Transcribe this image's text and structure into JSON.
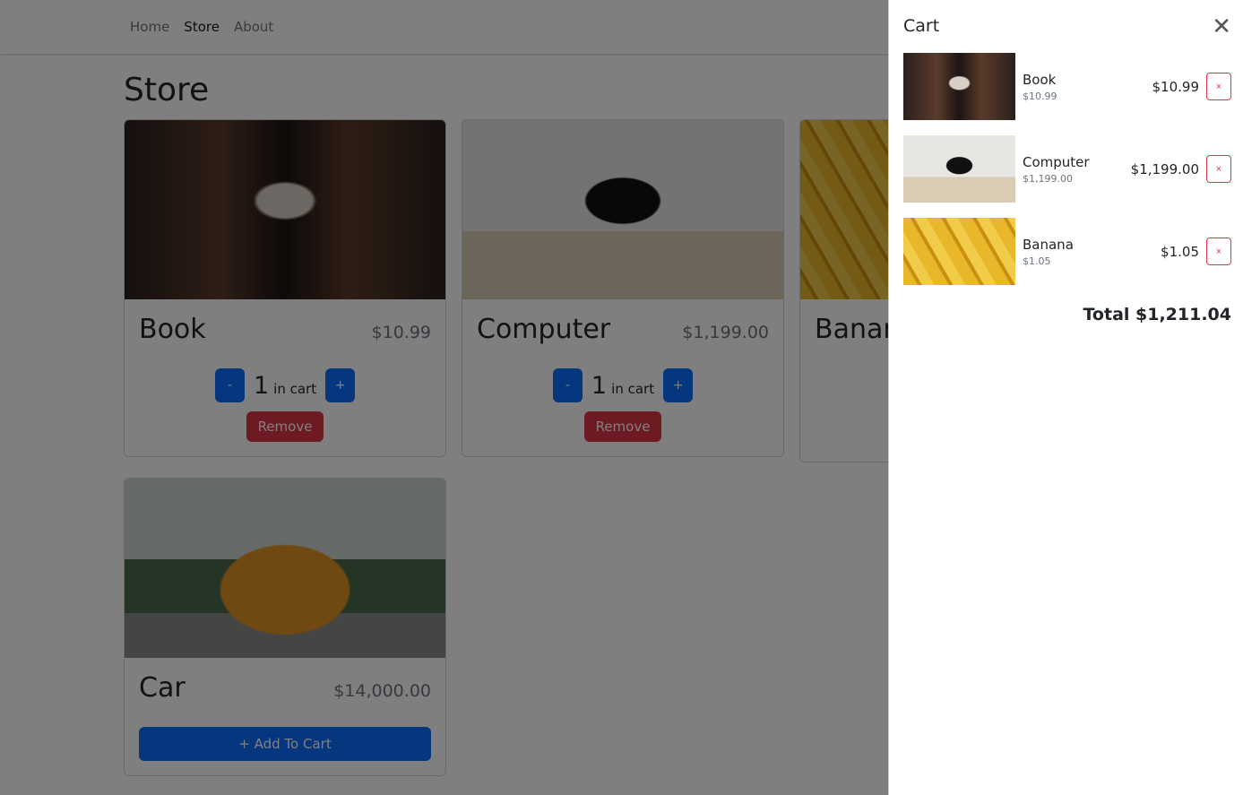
{
  "nav": {
    "items": [
      {
        "label": "Home",
        "active": false
      },
      {
        "label": "Store",
        "active": true
      },
      {
        "label": "About",
        "active": false
      }
    ]
  },
  "page": {
    "title": "Store"
  },
  "products": [
    {
      "name": "Book",
      "price": "$10.99",
      "quantity": "1",
      "in_cart_label": "in cart",
      "minus": "-",
      "plus": "+",
      "remove": "Remove"
    },
    {
      "name": "Computer",
      "price": "$1,199.00",
      "quantity": "1",
      "in_cart_label": "in cart",
      "minus": "-",
      "plus": "+",
      "remove": "Remove"
    },
    {
      "name": "Banana"
    },
    {
      "name": "Car",
      "price": "$14,000.00",
      "add_label": "+ Add To Cart"
    }
  ],
  "cart": {
    "title": "Cart",
    "close_icon": "close-icon",
    "items": [
      {
        "name": "Book",
        "unit_price": "$10.99",
        "line_total": "$10.99",
        "remove": "×"
      },
      {
        "name": "Computer",
        "unit_price": "$1,199.00",
        "line_total": "$1,199.00",
        "remove": "×"
      },
      {
        "name": "Banana",
        "unit_price": "$1.05",
        "line_total": "$1.05",
        "remove": "×"
      }
    ],
    "total": "Total $1,211.04"
  },
  "colors": {
    "primary": "#0d6efd",
    "danger": "#dc3545"
  }
}
